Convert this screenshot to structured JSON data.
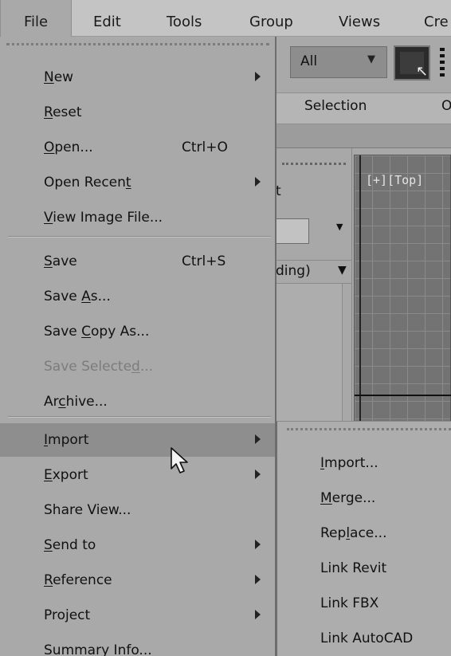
{
  "menubar": {
    "items": [
      {
        "label": "File"
      },
      {
        "label": "Edit"
      },
      {
        "label": "Tools"
      },
      {
        "label": "Group"
      },
      {
        "label": "Views"
      },
      {
        "label": "Cre"
      }
    ]
  },
  "toolbar": {
    "selection_filter": "All",
    "ribbon_tab_selection": "Selection",
    "ribbon_tab_cut": "O"
  },
  "scene_panel": {
    "partial_text": "t",
    "sort_label": "ding)"
  },
  "viewport": {
    "label": "[+][Top]"
  },
  "file_menu": {
    "items": [
      {
        "pre": "",
        "u": "N",
        "post": "ew",
        "shortcut": "",
        "submenu": true
      },
      {
        "pre": "",
        "u": "R",
        "post": "eset",
        "shortcut": "",
        "submenu": false
      },
      {
        "pre": "",
        "u": "O",
        "post": "pen...",
        "shortcut": "Ctrl+O",
        "submenu": false
      },
      {
        "pre": "Open Recen",
        "u": "t",
        "post": "",
        "shortcut": "",
        "submenu": true
      },
      {
        "pre": "",
        "u": "V",
        "post": "iew Image File...",
        "shortcut": "",
        "submenu": false
      },
      {
        "pre": "",
        "u": "S",
        "post": "ave",
        "shortcut": "Ctrl+S",
        "submenu": false
      },
      {
        "pre": "Save ",
        "u": "A",
        "post": "s...",
        "shortcut": "",
        "submenu": false
      },
      {
        "pre": "Save ",
        "u": "C",
        "post": "opy As...",
        "shortcut": "",
        "submenu": false
      },
      {
        "pre": "Save Selecte",
        "u": "d",
        "post": "...",
        "shortcut": "",
        "submenu": false
      },
      {
        "pre": "Ar",
        "u": "c",
        "post": "hive...",
        "shortcut": "",
        "submenu": false
      },
      {
        "pre": "",
        "u": "I",
        "post": "mport",
        "shortcut": "",
        "submenu": true
      },
      {
        "pre": "",
        "u": "E",
        "post": "xport",
        "shortcut": "",
        "submenu": true
      },
      {
        "pre": "Share View...",
        "u": "",
        "post": "",
        "shortcut": "",
        "submenu": false
      },
      {
        "pre": "",
        "u": "S",
        "post": "end to",
        "shortcut": "",
        "submenu": true
      },
      {
        "pre": "",
        "u": "R",
        "post": "eference",
        "shortcut": "",
        "submenu": true
      },
      {
        "pre": "Project",
        "u": "",
        "post": "",
        "shortcut": "",
        "submenu": true
      },
      {
        "pre": "Summary Info...",
        "u": "",
        "post": "",
        "shortcut": "",
        "submenu": false
      }
    ]
  },
  "import_submenu": {
    "items": [
      {
        "pre": "",
        "u": "I",
        "post": "mport..."
      },
      {
        "pre": "",
        "u": "M",
        "post": "erge..."
      },
      {
        "pre": "Rep",
        "u": "l",
        "post": "ace..."
      },
      {
        "pre": "Link Revit",
        "u": "",
        "post": ""
      },
      {
        "pre": "Link FBX",
        "u": "",
        "post": ""
      },
      {
        "pre": "Link AutoCAD",
        "u": "",
        "post": ""
      }
    ]
  },
  "colors": {
    "menu_bg": "#a9a9a9",
    "menubar_bg": "#c4c4c4",
    "hover_bg": "#8e8e8e",
    "disabled_text": "#7c7c7c"
  },
  "icons": {
    "cursor": "mouse-pointer-icon",
    "submenu": "submenu-arrow-icon"
  }
}
